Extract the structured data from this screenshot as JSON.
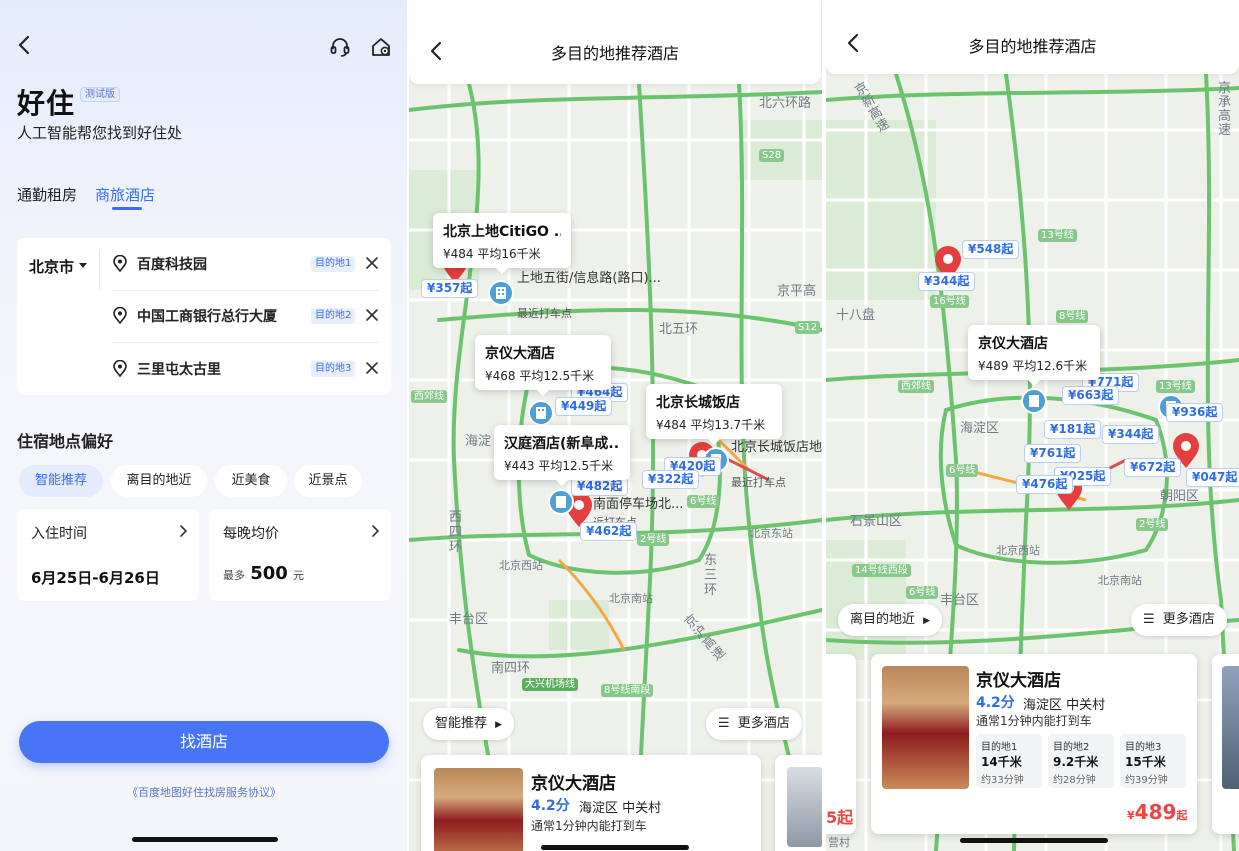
{
  "colors": {
    "accent": "#3a6cf4",
    "pin_red": "#e53e3e",
    "price_blue": "#2f6de3",
    "cta": "#4775f6"
  },
  "screen1": {
    "brand": "好住",
    "beta": "测试版",
    "slogan": "人工智能帮您找到好住处",
    "tabs": [
      "通勤租房",
      "商旅酒店"
    ],
    "city": "北京市",
    "destinations": [
      {
        "name": "百度科技园",
        "tag": "目的地1"
      },
      {
        "name": "中国工商银行总行大厦",
        "tag": "目的地2"
      },
      {
        "name": "三里屯太古里",
        "tag": "目的地3"
      }
    ],
    "pref_title": "住宿地点偏好",
    "prefs": [
      "智能推荐",
      "离目的地近",
      "近美食",
      "近景点"
    ],
    "checkin_label": "入住时间",
    "checkin_value": "6月25日-6月26日",
    "price_label": "每晚均价",
    "price_prefix": "最多",
    "price_value": "500",
    "price_unit": "元",
    "cta": "找酒店",
    "agreement": "《百度地图好住找房服务协议》",
    "icons": [
      "back-icon",
      "headset-icon",
      "home-settings-icon",
      "location-pin-icon",
      "close-icon",
      "chevron-right-icon"
    ]
  },
  "screen2": {
    "title": "多目的地推荐酒店",
    "map_labels": [
      "北六环路",
      "北五环",
      "京平高",
      "西四环",
      "海淀",
      "丰台区",
      "南四环",
      "东三环",
      "京沪高速",
      "北京东站",
      "北京西站",
      "北京南站"
    ],
    "road_badges": [
      "S28",
      "S12",
      "西郊线",
      "6号线",
      "2号线",
      "大兴机场线",
      "8号线南段"
    ],
    "popups": [
      {
        "title": "北京上地CitiGO ...",
        "sub": "¥484 平均16千米"
      },
      {
        "title": "京仪大酒店",
        "sub": "¥468 平均12.5千米"
      },
      {
        "title": "北京长城饭店",
        "sub": "¥484 平均13.7千米"
      },
      {
        "title": "汉庭酒店(新阜成...",
        "sub": "¥443 平均12.5千米"
      }
    ],
    "price_tags": [
      "¥357起",
      "¥464起",
      "¥449起",
      "¥420起",
      "¥482起",
      "¥322起",
      "¥462起"
    ],
    "pois": [
      {
        "title": "上地五街/信息路(路口)...",
        "sub": "最近打车点"
      },
      {
        "title": "北京长城饭店地上停车场-...",
        "sub": "最近打车点"
      },
      {
        "title": "南面停车场北...",
        "sub": "近打车点"
      }
    ],
    "sort_button": "智能推荐",
    "more_button": "更多酒店",
    "card": {
      "name": "京仪大酒店",
      "rating": "4.2分",
      "area": "海淀区 中关村",
      "parking": "通常1分钟内能打到车"
    }
  },
  "screen3": {
    "title": "多目的地推荐酒店",
    "map_labels": [
      "京新高速",
      "十八盘",
      "海淀区",
      "石景山区",
      "丰台区",
      "朝阳区",
      "北京西站",
      "北京南站",
      "京承高速"
    ],
    "road_badges": [
      "13号线",
      "16号线",
      "8号线",
      "西郊线",
      "6号线",
      "2号线",
      "13号线",
      "14号线西段",
      "6号线"
    ],
    "popup": {
      "title": "京仪大酒店",
      "sub": "¥489 平均12.6千米"
    },
    "price_tags": [
      "¥548起",
      "¥344起",
      "¥771起",
      "¥663起",
      "¥936起",
      "¥181起",
      "¥344起",
      "¥761起",
      "¥672起",
      "¥025起",
      "¥476起",
      "¥047起"
    ],
    "sort_button": "离目的地近",
    "more_button": "更多酒店",
    "card": {
      "name": "京仪大酒店",
      "rating": "4.2分",
      "area": "海淀区 中关村",
      "parking": "通常1分钟内能打到车",
      "distances": [
        {
          "label": "目的地1",
          "km": "14千米",
          "time": "约33分钟"
        },
        {
          "label": "目的地2",
          "km": "9.2千米",
          "time": "约28分钟"
        },
        {
          "label": "目的地3",
          "km": "15千米",
          "time": "约39分钟"
        }
      ],
      "price_symbol": "¥",
      "price": "489",
      "price_suffix": "起"
    },
    "side_card_left_price": "5起",
    "side_card_left_label": "营村"
  }
}
